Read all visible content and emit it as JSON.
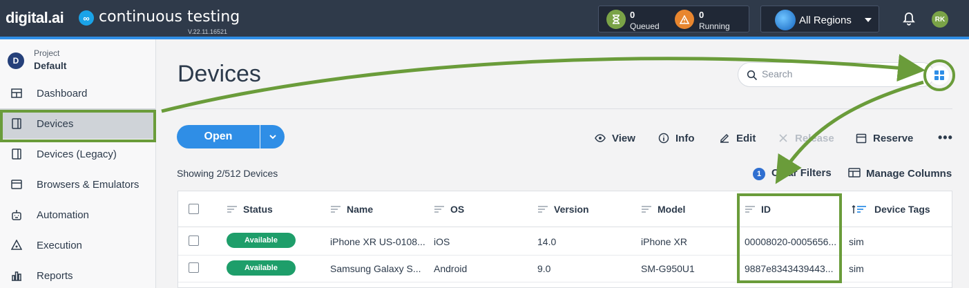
{
  "header": {
    "brand": "digital.ai",
    "brand_logo_glyph": "∞",
    "product": "continuous testing",
    "version": "V.22.11.16521",
    "queued": {
      "count": "0",
      "label": "Queued",
      "icon": "hourglass-icon",
      "color": "#7aa347"
    },
    "running": {
      "count": "0",
      "label": "Running",
      "icon": "warning-icon",
      "color": "#e8862f"
    },
    "region": "All Regions",
    "avatar": "RK"
  },
  "sidebar": {
    "project_badge": "D",
    "project_label": "Project",
    "project_name": "Default",
    "items": [
      {
        "label": "Dashboard",
        "icon": "dashboard-icon"
      },
      {
        "label": "Devices",
        "icon": "device-icon",
        "active": true
      },
      {
        "label": "Devices (Legacy)",
        "icon": "device-legacy-icon"
      },
      {
        "label": "Browsers & Emulators",
        "icon": "browser-icon"
      },
      {
        "label": "Automation",
        "icon": "automation-icon"
      },
      {
        "label": "Execution",
        "icon": "execution-icon"
      },
      {
        "label": "Reports",
        "icon": "reports-icon"
      }
    ]
  },
  "main": {
    "title": "Devices",
    "search_placeholder": "Search",
    "open_label": "Open",
    "actions": {
      "view": "View",
      "info": "Info",
      "edit": "Edit",
      "release": "Release",
      "reserve": "Reserve",
      "more": "•••"
    },
    "showing": "Showing 2/512 Devices",
    "filter_count": "1",
    "clear_filters": "Clear Filters",
    "manage_columns": "Manage Columns"
  },
  "table": {
    "columns": [
      "Status",
      "Name",
      "OS",
      "Version",
      "Model",
      "ID",
      "Device Tags"
    ],
    "rows": [
      {
        "status": "Available",
        "name": "iPhone XR US-0108...",
        "os": "iOS",
        "version": "14.0",
        "model": "iPhone XR",
        "id": "00008020-0005656...",
        "tags": "sim"
      },
      {
        "status": "Available",
        "name": "Samsung Galaxy S...",
        "os": "Android",
        "version": "9.0",
        "model": "SM-G950U1",
        "id": "9887e8343439443...",
        "tags": "sim"
      }
    ]
  },
  "colors": {
    "header_bg": "#2f3a4a",
    "accent": "#2f8ee6",
    "status_available": "#1e9e6a",
    "annotation": "#6a9c3a"
  }
}
